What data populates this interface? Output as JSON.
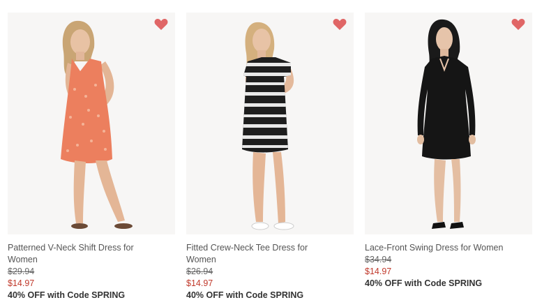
{
  "accent_colors": {
    "favorite_heart": "#e06666",
    "sale_price": "#c0392b"
  },
  "products": [
    {
      "name": "Patterned V-Neck Shift Dress for Women",
      "original_price": "$29.94",
      "sale_price": "$14.97",
      "promo": "40% OFF with Code SPRING",
      "favorite_icon": "heart-icon"
    },
    {
      "name": "Fitted Crew-Neck Tee Dress for Women",
      "original_price": "$26.94",
      "sale_price": "$14.97",
      "promo": "40% OFF with Code SPRING",
      "favorite_icon": "heart-icon"
    },
    {
      "name": "Lace-Front Swing Dress for Women",
      "original_price": "$34.94",
      "sale_price": "$14.97",
      "promo": "40% OFF with Code SPRING",
      "favorite_icon": "heart-icon"
    }
  ]
}
